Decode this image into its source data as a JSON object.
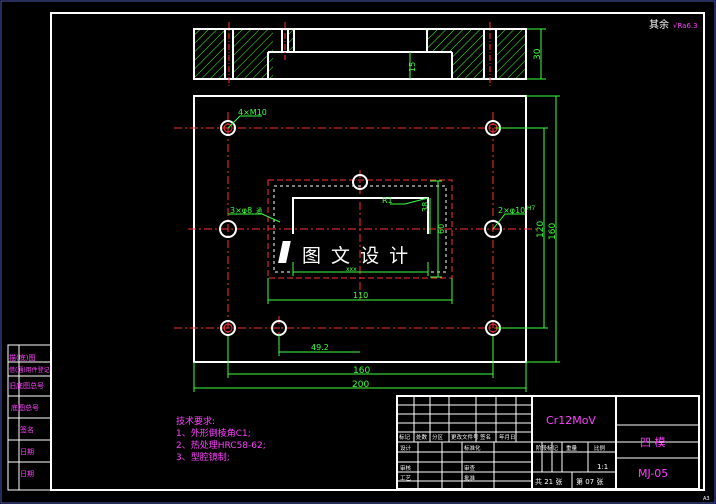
{
  "roughness": "其余",
  "roughness_sym": "√Ra6.3",
  "dims": {
    "d30": "30",
    "d15": "15",
    "hole4": "4×M10",
    "hole3": "3×φ8",
    "hole3b": "通",
    "hole2": "2×φ10",
    "hole2b": "H7",
    "r1": "R1",
    "d38": "38",
    "d60": "60",
    "d120": "120",
    "d160v": "160",
    "d110": "110",
    "d492": "49.2",
    "d160h": "160",
    "d200": "200",
    "dsmall": "xxx"
  },
  "watermark": "图 文 设 计",
  "tech": {
    "title": "技术要求:",
    "items": [
      "1、外形倒棱角C1;",
      "2、热处理HRC58-62;",
      "3、型腔镜制;"
    ]
  },
  "sidebar": [
    "描(底)图",
    "借(通)用件登记",
    "旧底图总号",
    "底图总号",
    "签名",
    "日期",
    "日期"
  ],
  "titleblock": {
    "material": "Cr12MoV",
    "name": "凹  模",
    "code": "MJ-05",
    "scale": "1:1",
    "total": "共 21 张",
    "sheet": "第 07 张",
    "row_labels": [
      "标记",
      "处数",
      "分区",
      "更改文件号",
      "签名",
      "年月日"
    ],
    "design": "设计",
    "std": "标准化",
    "check": "审核",
    "process": "工艺",
    "approve": "批准",
    "review": "审查",
    "stage": "阶段标记",
    "weight": "重量",
    "ratio": "比例"
  },
  "corner": "A3"
}
